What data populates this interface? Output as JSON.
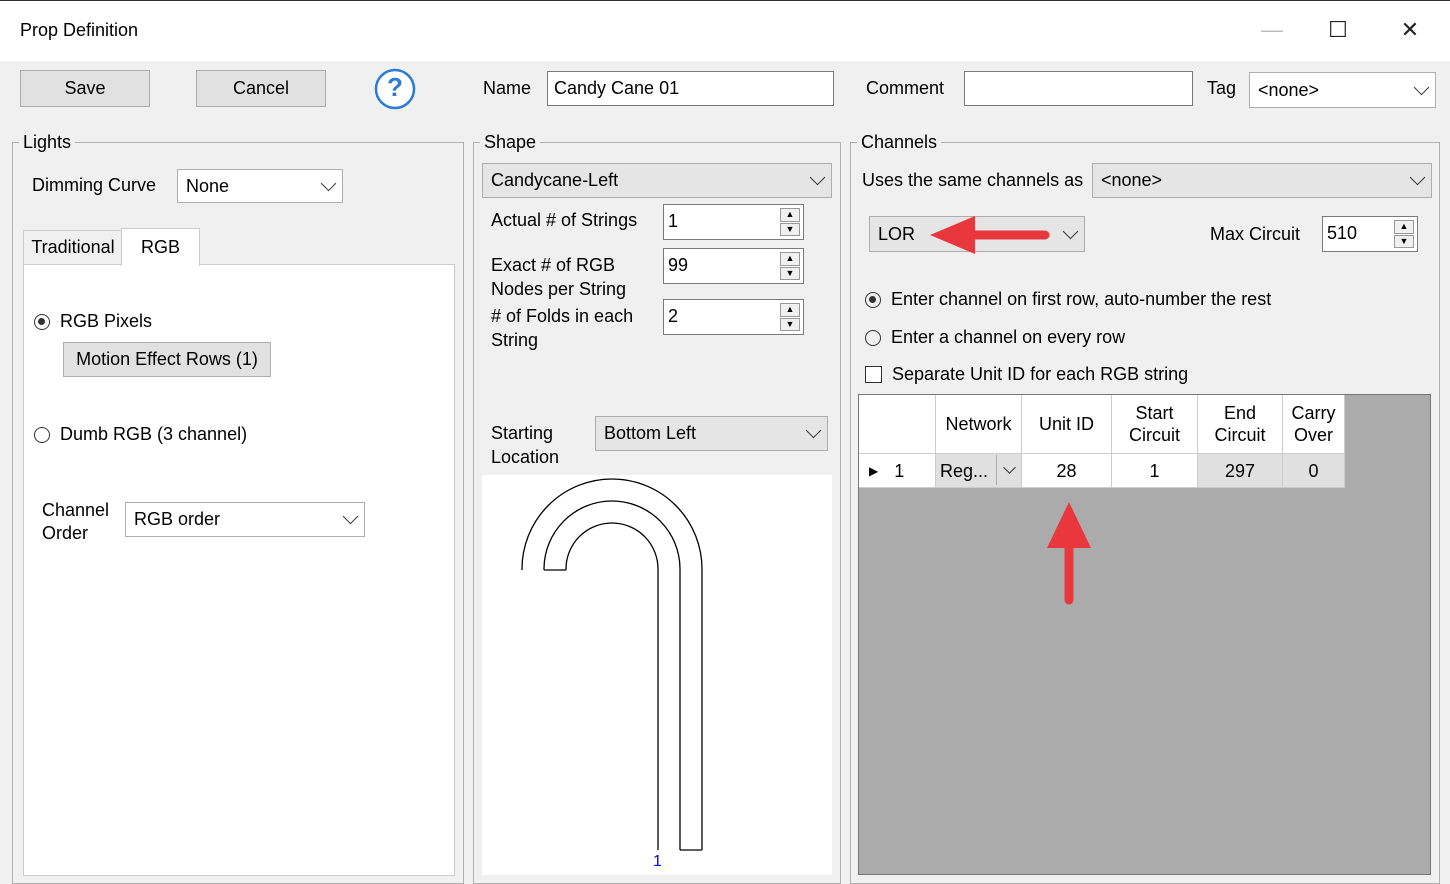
{
  "window": {
    "title": "Prop Definition",
    "minimize": "—",
    "maximize": "☐",
    "close": "✕"
  },
  "toolbar": {
    "save_label": "Save",
    "cancel_label": "Cancel",
    "help_glyph": "?",
    "name_label": "Name",
    "name_value": "Candy Cane 01",
    "comment_label": "Comment",
    "comment_value": "",
    "tag_label": "Tag",
    "tag_value": "<none>"
  },
  "lights": {
    "legend": "Lights",
    "dimming_label": "Dimming Curve",
    "dimming_value": "None",
    "tabs": [
      {
        "label": "Traditional"
      },
      {
        "label": "RGB",
        "active": true
      }
    ],
    "rgb_pixels_label": "RGB Pixels",
    "motion_button": "Motion Effect Rows (1)",
    "dumb_rgb_label": "Dumb RGB (3 channel)",
    "channel_order_label_1": "Channel",
    "channel_order_label_2": "Order",
    "channel_order_value": "RGB order"
  },
  "shape": {
    "legend": "Shape",
    "shape_value": "Candycane-Left",
    "strings_label": "Actual # of Strings",
    "strings_value": "1",
    "nodes_label_1": "Exact # of RGB",
    "nodes_label_2": "Nodes per String",
    "nodes_value": "99",
    "folds_label_1": "# of Folds in each",
    "folds_label_2": "String",
    "folds_value": "2",
    "start_label_1": "Starting",
    "start_label_2": "Location",
    "start_value": "Bottom Left",
    "preview_marker": "1"
  },
  "channels": {
    "legend": "Channels",
    "same_label": "Uses the same channels as",
    "same_value": "<none>",
    "type_value": "LOR",
    "max_label": "Max Circuit",
    "max_value": "510",
    "radio_first": "Enter channel on first row, auto-number the rest",
    "radio_every": "Enter a channel on every row",
    "separate_label": "Separate Unit ID for each RGB string",
    "grid": {
      "headers": [
        "Network",
        "Unit ID",
        "Start Circuit",
        "End Circuit",
        "Carry Over"
      ],
      "header_lines": [
        [
          "Network"
        ],
        [
          "Unit ID"
        ],
        [
          "Start",
          "Circuit"
        ],
        [
          "End",
          "Circuit"
        ],
        [
          "Carry",
          "Over"
        ]
      ],
      "rows": [
        {
          "index": "1",
          "network": "Reg...",
          "unit_id": "28",
          "start": "1",
          "end": "297",
          "carry": "0"
        }
      ]
    }
  },
  "colors": {
    "arrow": "#e8383d",
    "marker": "#0000ff",
    "grid_bg": "#ababab"
  }
}
